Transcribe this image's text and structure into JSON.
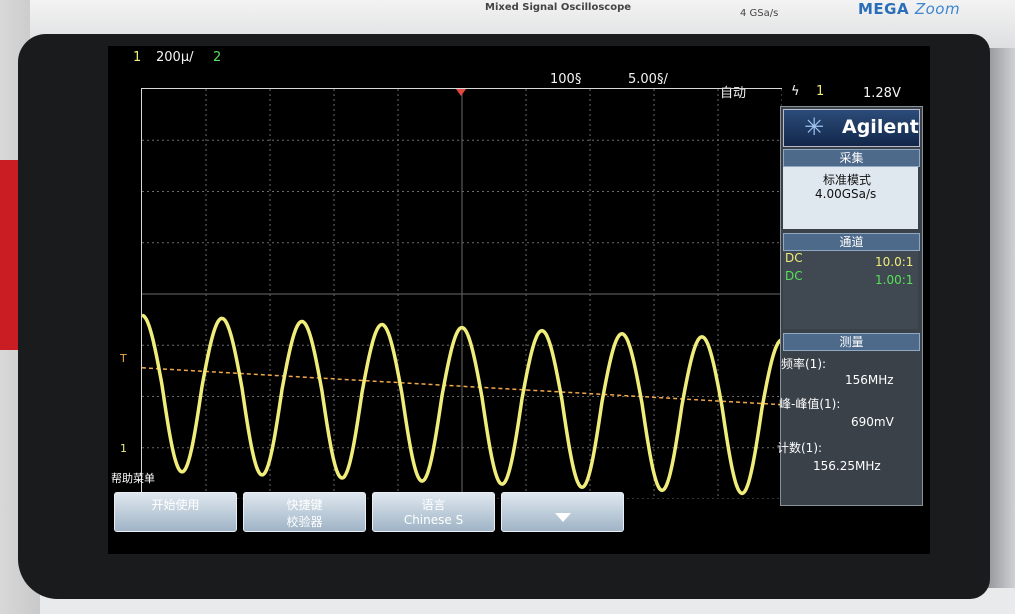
{
  "branding": {
    "model_text": "Mixed Signal Oscilloscope",
    "sample_rate": "4 GSa/s",
    "mega_logo": "MEGA",
    "zoom_logo": "Zoom",
    "vendor": "Agilent"
  },
  "header": {
    "ch1_label": "1",
    "ch1_scale": "200µ/",
    "ch2_label": "2",
    "time_position": "100§",
    "time_scale": "5.00§/",
    "trigger_mode": "自动",
    "trigger_edge": "ϟ",
    "trigger_channel": "1",
    "trigger_level": "1.28V"
  },
  "markers": {
    "trigger_level_marker": "T",
    "ground_marker": "1"
  },
  "panel": {
    "acquire": {
      "header": "采集",
      "mode": "标准模式",
      "rate": "4.00GSa/s"
    },
    "channels": {
      "header": "通道",
      "rows": [
        {
          "coupling": "DC",
          "probe": "10.0:1"
        },
        {
          "coupling": "DC",
          "probe": "1.00:1"
        }
      ]
    },
    "measurements": {
      "header": "测量",
      "items": [
        {
          "label": "频率(1):",
          "value": "156MHz"
        },
        {
          "label": "峰-峰值(1):",
          "value": "690mV"
        },
        {
          "label": "计数(1):",
          "value": "156.25MHz"
        }
      ]
    }
  },
  "softkeys": {
    "help_label": "帮助菜单",
    "buttons": [
      {
        "line1": "开始使用",
        "line2": ""
      },
      {
        "line1": "快捷键",
        "line2": "校验器"
      },
      {
        "line1": "语言",
        "line2": "Chinese S"
      },
      {
        "line1": "",
        "line2": ""
      }
    ]
  },
  "colors": {
    "channel1": "#f0ed7a",
    "channel2": "#58e05a",
    "trigger": "#e3473f",
    "trigger_level_line": "#f0a74c"
  },
  "chart_data": {
    "type": "line",
    "series": [
      {
        "values": [
          0.8,
          -1.0,
          0.8,
          -1.0,
          0.8,
          -1.0,
          0.8,
          -1.0,
          0.8,
          -1.0,
          0.8,
          -1.0,
          0.8,
          -1.0,
          0.8,
          -1.0
        ]
      }
    ],
    "grid": true,
    "horizontal_divisions": 10,
    "vertical_divisions": 8
  }
}
